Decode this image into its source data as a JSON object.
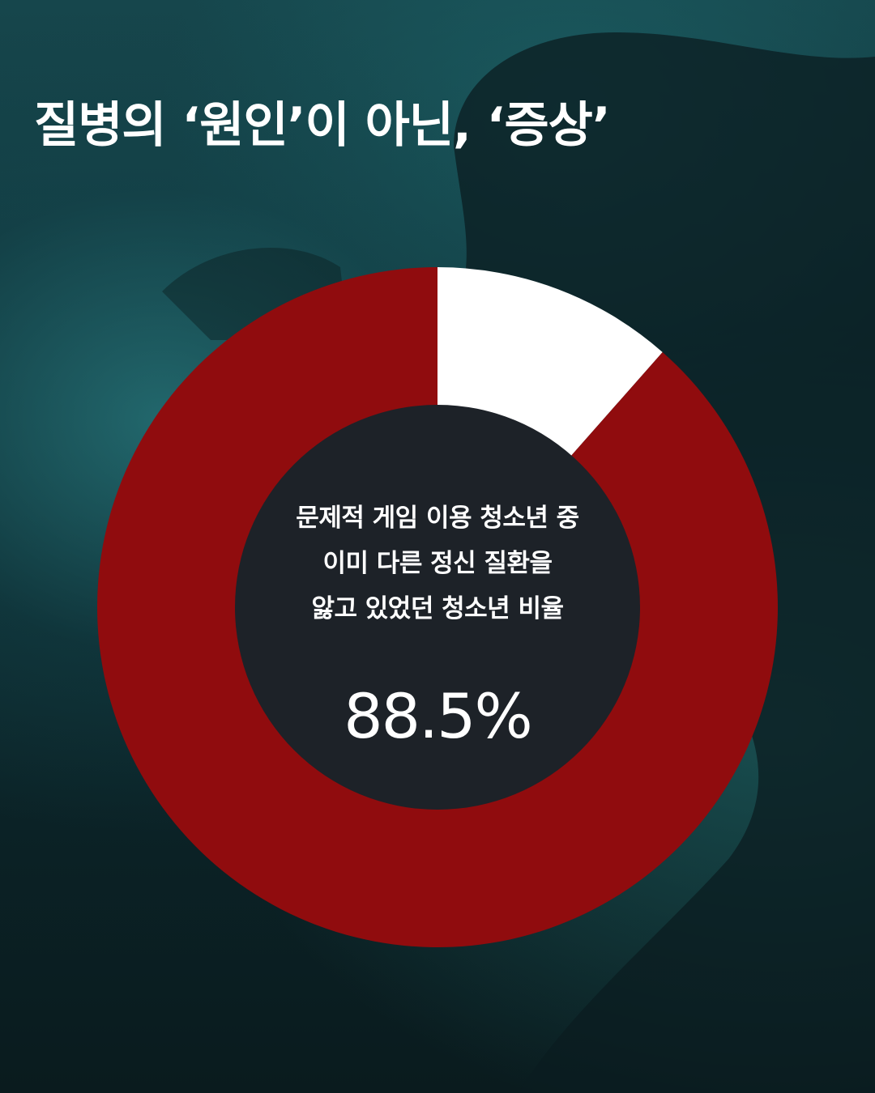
{
  "title": "질병의 ‘원인’이 아닌, ‘증상’",
  "colors": {
    "primary_slice": "#900c0e",
    "secondary_slice": "#ffffff",
    "hole": "#1d2228",
    "text": "#ffffff"
  },
  "chart_data": {
    "type": "pie",
    "variant": "donut",
    "center_text": [
      "문제적 게임 이용 청소년 중",
      "이미 다른 정신 질환을",
      "앓고 있었던 청소년 비율"
    ],
    "center_value": "88.5%",
    "slices": [
      {
        "value": 88.5,
        "color": "#900c0e"
      },
      {
        "value": 11.5,
        "color": "#ffffff"
      }
    ]
  }
}
